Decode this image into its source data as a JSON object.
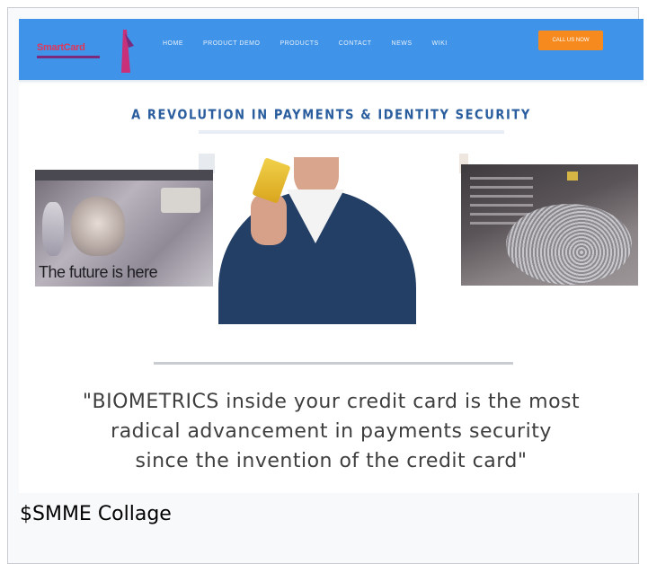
{
  "site": {
    "nav": {
      "logo_text": "SmartCard",
      "links": [
        "HOME",
        "PRODUCT DEMO",
        "PRODUCTS",
        "CONTACT",
        "NEWS",
        "WIKI"
      ],
      "cta_label": "CALL US NOW"
    },
    "headline": "A REVOLUTION IN PAYMENTS & IDENTITY SECURITY",
    "collage": {
      "left_panel_caption": "The future is here"
    },
    "quote_lines": [
      "\"BIOMETRICS inside your credit card is the most",
      "radical advancement in payments security",
      "since the invention of the credit card\""
    ]
  },
  "gallery": {
    "caption": "$SMME Collage"
  },
  "colors": {
    "nav_bg": "#3f93e8",
    "cta_bg": "#f68a1f",
    "headline": "#2a5d9e"
  }
}
